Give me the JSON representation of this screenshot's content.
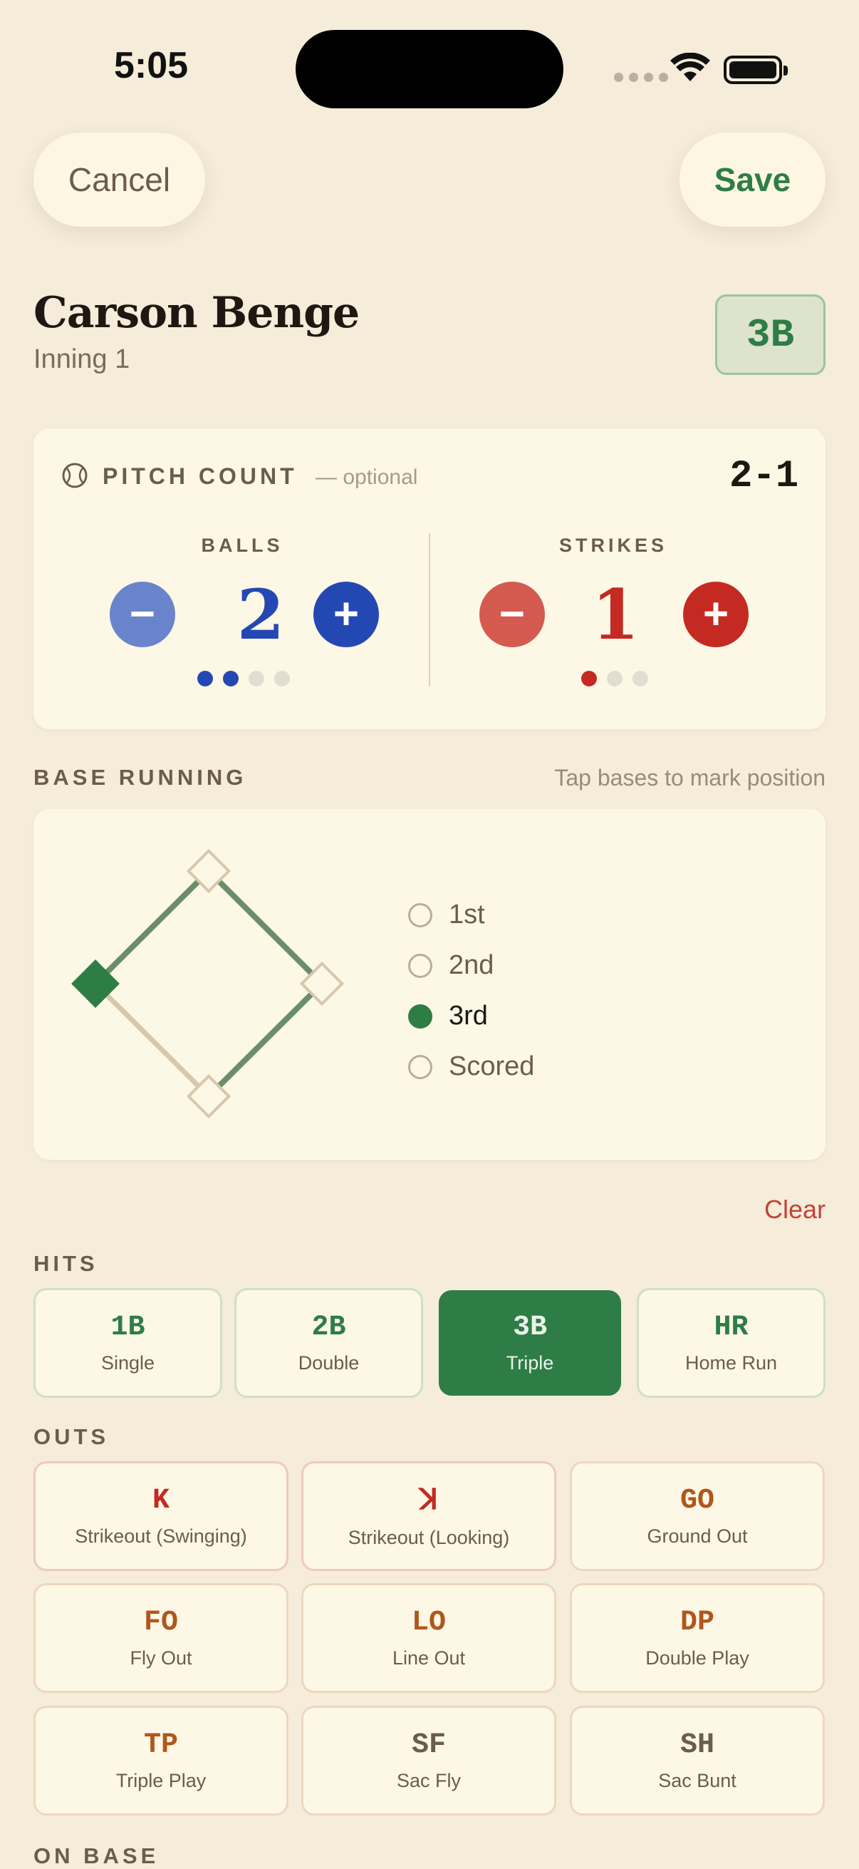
{
  "status_bar": {
    "time": "5:05"
  },
  "nav": {
    "cancel_label": "Cancel",
    "save_label": "Save"
  },
  "header": {
    "player_name": "Carson Benge",
    "inning": "Inning 1",
    "result_badge": "3B"
  },
  "pitch_count": {
    "title": "PITCH COUNT",
    "optional": "— optional",
    "total": "2-1",
    "balls": {
      "label": "BALLS",
      "value": "2",
      "filled": 2,
      "max": 4,
      "color": "#2448b3"
    },
    "strikes": {
      "label": "STRIKES",
      "value": "1",
      "filled": 1,
      "max": 3,
      "color": "#c42a22"
    },
    "minus_symbol": "−",
    "plus_symbol": "+"
  },
  "base_running": {
    "title": "BASE RUNNING",
    "hint": "Tap bases to mark position",
    "options": [
      {
        "label": "1st",
        "selected": false
      },
      {
        "label": "2nd",
        "selected": false
      },
      {
        "label": "3rd",
        "selected": true
      },
      {
        "label": "Scored",
        "selected": false
      }
    ],
    "clear_label": "Clear"
  },
  "hits": {
    "title": "HITS",
    "items": [
      {
        "code": "1B",
        "name": "Single",
        "selected": false
      },
      {
        "code": "2B",
        "name": "Double",
        "selected": false
      },
      {
        "code": "3B",
        "name": "Triple",
        "selected": true
      },
      {
        "code": "HR",
        "name": "Home Run",
        "selected": false
      }
    ]
  },
  "outs": {
    "title": "OUTS",
    "items": [
      {
        "code": "K",
        "name": "Strikeout (Swinging)"
      },
      {
        "code": "ꓘ",
        "name": "Strikeout (Looking)"
      },
      {
        "code": "GO",
        "name": "Ground Out"
      },
      {
        "code": "FO",
        "name": "Fly Out"
      },
      {
        "code": "LO",
        "name": "Line Out"
      },
      {
        "code": "DP",
        "name": "Double Play"
      },
      {
        "code": "TP",
        "name": "Triple Play"
      },
      {
        "code": "SF",
        "name": "Sac Fly"
      },
      {
        "code": "SH",
        "name": "Sac Bunt"
      }
    ]
  },
  "on_base": {
    "title": "ON BASE"
  },
  "colors": {
    "accent_green": "#2e7d46",
    "ball_blue": "#2448b3",
    "strike_red": "#c42a22",
    "background": "#f5ecd9"
  }
}
